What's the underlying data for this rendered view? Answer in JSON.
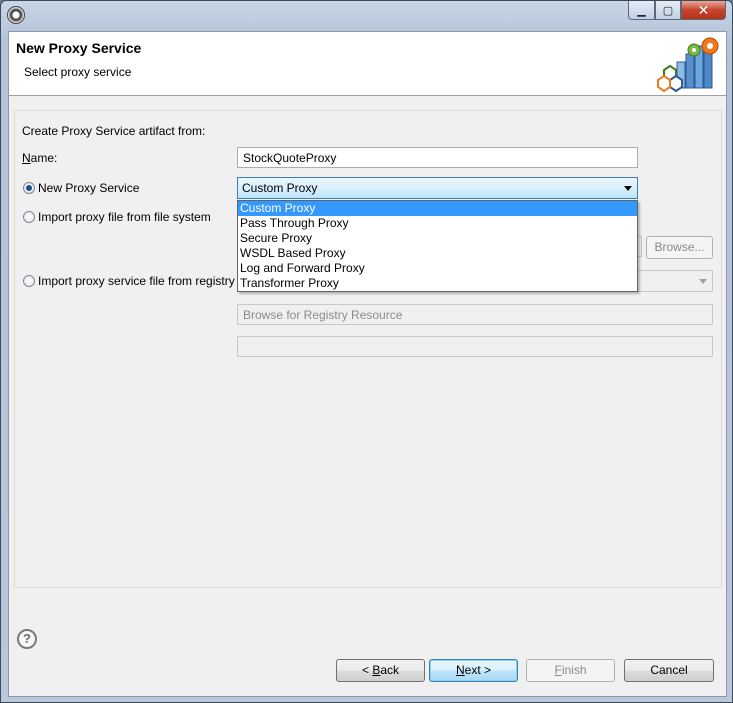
{
  "header": {
    "title": "New Proxy Service",
    "subtitle": "Select proxy service"
  },
  "form": {
    "section_label": "Create Proxy Service artifact from:",
    "name_label": "Name:",
    "name_value": "StockQuoteProxy",
    "options": [
      {
        "label": "New Proxy Service",
        "selected": true
      },
      {
        "label": "Import proxy file from file system",
        "selected": false
      },
      {
        "label": "Import proxy service file from registry",
        "selected": false
      }
    ],
    "proxy_type": {
      "value": "Custom Proxy",
      "items": [
        "Custom Proxy",
        "Pass Through Proxy",
        "Secure Proxy",
        "WSDL Based Proxy",
        "Log and Forward Proxy",
        "Transformer Proxy"
      ],
      "highlighted_index": 0
    },
    "browse_label": "Browse...",
    "browse_registry_placeholder": "Browse for Registry Resource"
  },
  "footer": {
    "back_label_prefix": "< ",
    "back_label_underline": "B",
    "back_label_rest": "ack",
    "next_label_underline": "N",
    "next_label_rest": "ext >",
    "finish_label_underline": "F",
    "finish_label_rest": "inish",
    "cancel_label": "Cancel",
    "help_glyph": "?"
  },
  "colors": {
    "selection": "#3399ff",
    "default_button_border": "#3c7fb1",
    "close_button": "#c7442c"
  }
}
